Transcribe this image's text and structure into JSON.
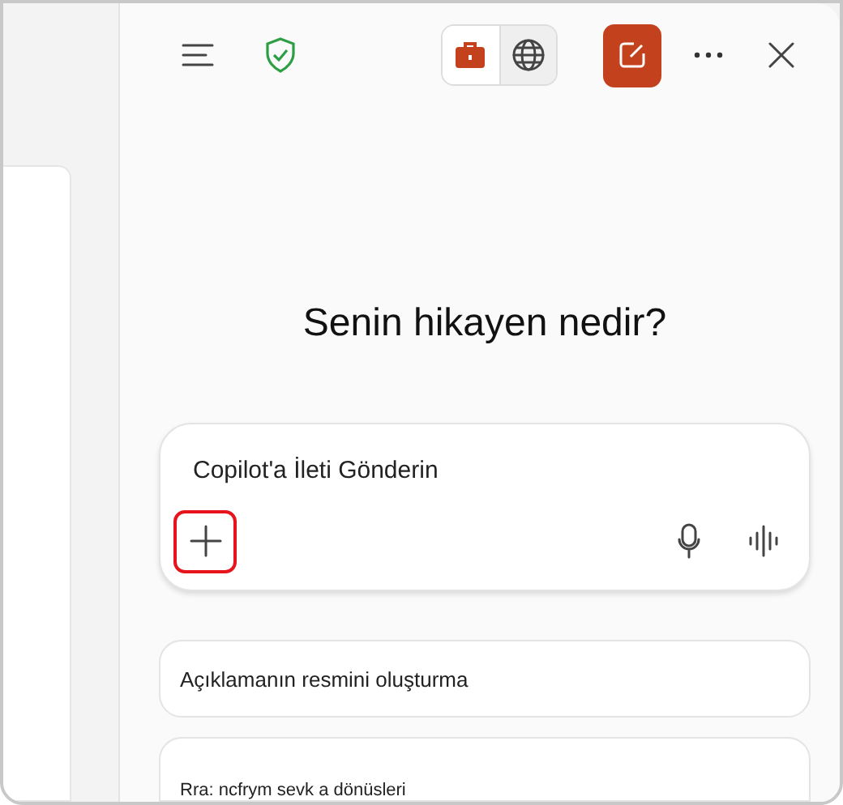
{
  "header": {
    "modes": [
      {
        "kind": "work",
        "selected": true
      },
      {
        "kind": "web",
        "selected": false
      }
    ]
  },
  "heading": "Senin hikayen nedir?",
  "composer": {
    "placeholder": "Copilot'a İleti Gönderin",
    "add_highlighted": true
  },
  "suggestions": [
    {
      "text": "Açıklamanın resmini oluşturma"
    },
    {
      "text": "Rra: ncfrym sevk a dönüsleri"
    }
  ]
}
